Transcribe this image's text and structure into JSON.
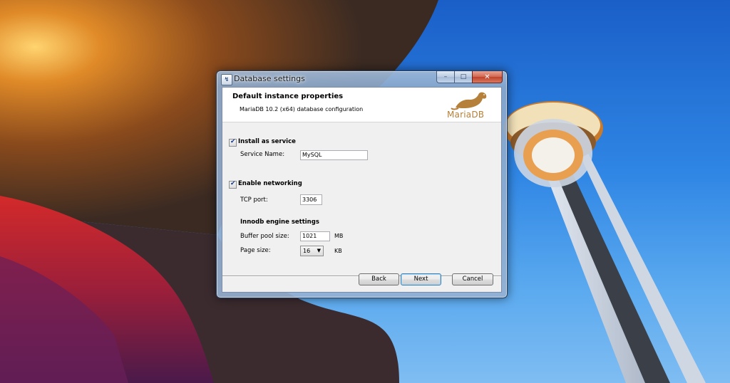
{
  "window": {
    "title": "Database settings",
    "app_icon": "installer-icon",
    "caption": {
      "minimize": "–",
      "maximize": "□",
      "close": "✕"
    }
  },
  "header": {
    "title": "Default instance properties",
    "subtitle": "MariaDB 10.2 (x64) database configuration",
    "logo_text": "MariaDB",
    "logo_color": "#b5803a"
  },
  "service": {
    "checkbox_label": "Install as service",
    "checked": true,
    "name_label": "Service Name:",
    "name_value": "MySQL"
  },
  "networking": {
    "checkbox_label": "Enable networking",
    "checked": true,
    "port_label": "TCP port:",
    "port_value": "3306"
  },
  "innodb": {
    "heading": "Innodb engine settings",
    "buffer_label": "Buffer pool size:",
    "buffer_value": "1021",
    "buffer_unit": "MB",
    "page_label": "Page size:",
    "page_value": "16",
    "page_unit": "KB"
  },
  "buttons": {
    "back": "Back",
    "next": "Next",
    "cancel": "Cancel"
  },
  "colors": {
    "accent": "#3c7fb1",
    "client_bg": "#f0f0f0"
  }
}
